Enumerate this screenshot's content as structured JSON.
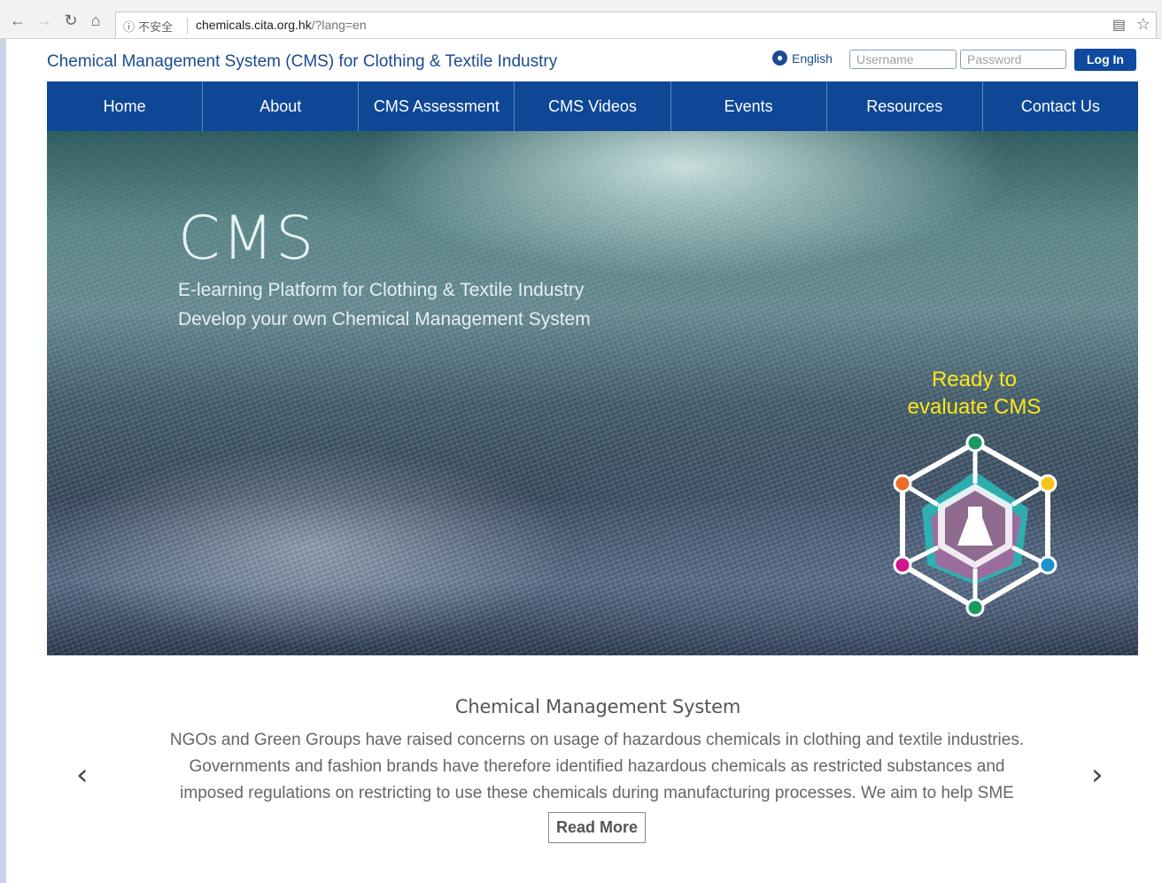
{
  "browser": {
    "security_label": "ⓘ 不安全",
    "url_host": "chemicals.cita.org.hk",
    "url_path": "/?lang=en"
  },
  "header": {
    "site_title": "Chemical Management System (CMS) for Clothing & Textile Industry",
    "language": "English",
    "username_placeholder": "Username",
    "password_placeholder": "Password",
    "login_label": "Log In"
  },
  "nav": {
    "items": [
      "Home",
      "About",
      "CMS Assessment",
      "CMS Videos",
      "Events",
      "Resources",
      "Contact Us"
    ]
  },
  "hero": {
    "heading": "CMS",
    "line1": "E-learning Platform for Clothing & Textile Industry",
    "line2": "Develop your own Chemical Management System",
    "cta_line1": "Ready to",
    "cta_line2": "evaluate CMS"
  },
  "carousel": {
    "title": "Chemical Management System",
    "text_line1": "NGOs and Green Groups have raised concerns on usage of hazardous chemicals in clothing and textile industries.",
    "text_line2": "Governments and fashion brands have therefore identified hazardous chemicals as restricted substances and",
    "text_line3": "imposed regulations on restricting to use these chemicals during manufacturing processes. We aim to help SME",
    "read_more": "Read More"
  },
  "colors": {
    "brand_blue": "#0f4797",
    "cta_yellow": "#ffe61a"
  }
}
